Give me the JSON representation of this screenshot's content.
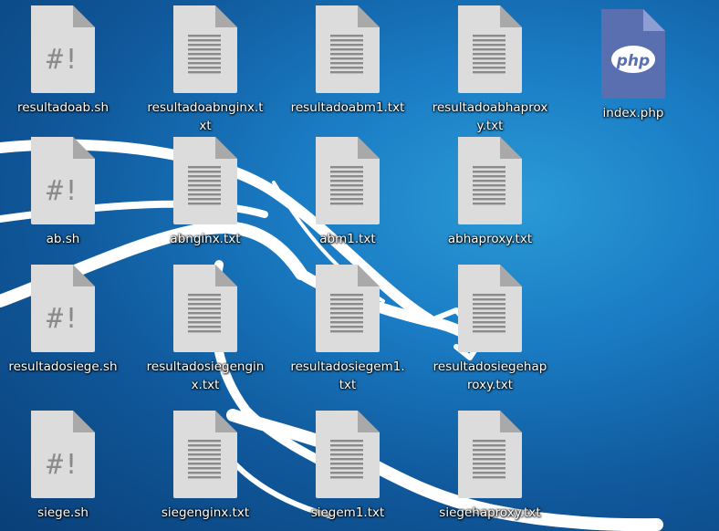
{
  "desktop": {
    "background_colors": {
      "light": "#2a9ad6",
      "mid": "#1a7cc4",
      "dark": "#0a3f78",
      "dragon": "#ffffff"
    },
    "icons": [
      {
        "label": "resultadoab.sh",
        "type": "shell-script",
        "icon": "shell-script-icon"
      },
      {
        "label": "resultadoabnginx.txt",
        "type": "text",
        "icon": "text-file-icon"
      },
      {
        "label": "resultadoabm1.txt",
        "type": "text",
        "icon": "text-file-icon"
      },
      {
        "label": "resultadoabhaproxy.txt",
        "type": "text",
        "icon": "text-file-icon"
      },
      {
        "label": "index.php",
        "type": "php",
        "icon": "php-file-icon"
      },
      {
        "label": "ab.sh",
        "type": "shell-script",
        "icon": "shell-script-icon"
      },
      {
        "label": "abnginx.txt",
        "type": "text",
        "icon": "text-file-icon"
      },
      {
        "label": "abm1.txt",
        "type": "text",
        "icon": "text-file-icon"
      },
      {
        "label": "abhaproxy.txt",
        "type": "text",
        "icon": "text-file-icon"
      },
      {
        "label": "resultadosiege.sh",
        "type": "shell-script",
        "icon": "shell-script-icon"
      },
      {
        "label": "resultadosiegenginx.txt",
        "type": "text",
        "icon": "text-file-icon"
      },
      {
        "label": "resultadosiegem1.txt",
        "type": "text",
        "icon": "text-file-icon"
      },
      {
        "label": "resultadosiegehaproxy.txt",
        "type": "text",
        "icon": "text-file-icon"
      },
      {
        "label": "siege.sh",
        "type": "shell-script",
        "icon": "shell-script-icon"
      },
      {
        "label": "siegenginx.txt",
        "type": "text",
        "icon": "text-file-icon"
      },
      {
        "label": "siegem1.txt",
        "type": "text",
        "icon": "text-file-icon"
      },
      {
        "label": "siegehaproxy.txt",
        "type": "text",
        "icon": "text-file-icon"
      }
    ],
    "php_badge_text": "php"
  }
}
